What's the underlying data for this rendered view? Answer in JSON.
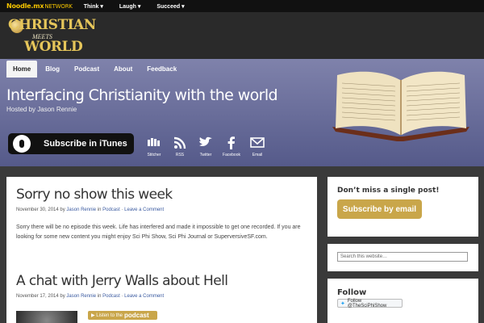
{
  "network": {
    "brand": "Noodle.mx",
    "brand_suffix": "NETWORK",
    "menu": [
      "Think ▾",
      "Laugh ▾",
      "Succeed ▾"
    ]
  },
  "logo": {
    "line1": "CHRISTIAN",
    "line2": "MEETS",
    "line3": "WORLD"
  },
  "nav": [
    {
      "label": "Home",
      "active": true
    },
    {
      "label": "Blog",
      "active": false
    },
    {
      "label": "Podcast",
      "active": false
    },
    {
      "label": "About",
      "active": false
    },
    {
      "label": "Feedback",
      "active": false
    }
  ],
  "hero": {
    "tagline": "Interfacing Christianity with the world",
    "hosted_by": "Hosted by Jason Rennie",
    "itunes_label": "Subscribe in iTunes",
    "socials": [
      {
        "icon": "stitcher-icon",
        "label": "Stitcher"
      },
      {
        "icon": "rss-icon",
        "label": "RSS"
      },
      {
        "icon": "twitter-icon",
        "label": "Twitter"
      },
      {
        "icon": "facebook-icon",
        "label": "Facebook"
      },
      {
        "icon": "email-icon",
        "label": "Email"
      }
    ]
  },
  "posts": [
    {
      "title": "Sorry no show this week",
      "date": "November 30, 2014",
      "by": "by",
      "author": "Jason Rennie",
      "in": "in",
      "category": "Podcast",
      "sep": "·",
      "comment": "Leave a Comment",
      "excerpt": "Sorry there will be no episode this week. Life has interfered and made it impossible to get one recorded. If you are looking for some new content you might enjoy Sci Phi Show, Sci Phi Journal or SuperversiveSF.com."
    },
    {
      "title": "A chat with Jerry Walls about Hell",
      "date": "November 17, 2014",
      "by": "by",
      "author": "Jason Rennie",
      "in": "in",
      "category": "Podcast",
      "sep": "·",
      "comment": "Leave a Comment",
      "listen_prefix": "Listen to the",
      "listen_label": "podcast"
    }
  ],
  "sidebar": {
    "dont_miss": "Don’t miss a single post!",
    "subscribe_email": "Subscribe by email",
    "search_placeholder": "Search this website…",
    "follow_title": "Follow",
    "follow_button": "Follow @TheSciPhiShow"
  },
  "colors": {
    "accent": "#c9a64a",
    "hero_top": "#7f82ab",
    "hero_bottom": "#555a8a",
    "link": "#3a5aa0"
  }
}
